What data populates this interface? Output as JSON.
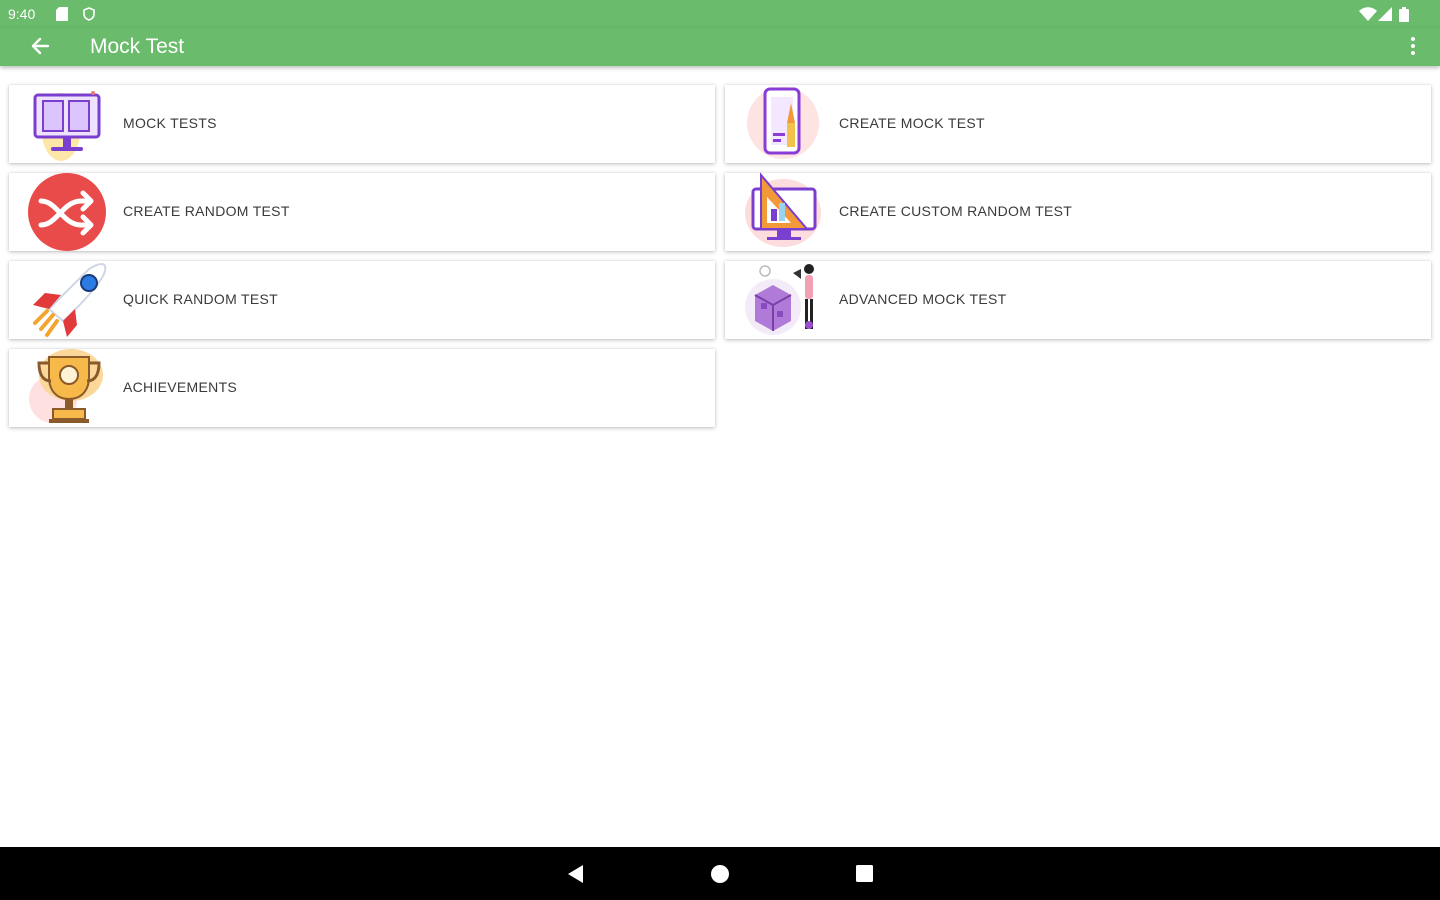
{
  "status_bar": {
    "time": "9:40",
    "left_icons": [
      "sd-card-icon",
      "shield-icon"
    ],
    "right_icons": [
      "wifi-icon",
      "signal-icon",
      "battery-icon"
    ]
  },
  "app_bar": {
    "title": "Mock Test",
    "back_icon": "arrow-back-icon",
    "menu_icon": "more-vertical-icon"
  },
  "menu_items": [
    {
      "label": "MOCK TESTS",
      "icon": "monitor-books-icon"
    },
    {
      "label": "CREATE MOCK TEST",
      "icon": "phone-pencil-icon"
    },
    {
      "label": "CREATE RANDOM TEST",
      "icon": "shuffle-icon"
    },
    {
      "label": "CREATE CUSTOM RANDOM TEST",
      "icon": "geometry-monitor-icon"
    },
    {
      "label": "QUICK RANDOM TEST",
      "icon": "rocket-icon"
    },
    {
      "label": "ADVANCED MOCK TEST",
      "icon": "cube-person-icon"
    },
    {
      "label": "ACHIEVEMENTS",
      "icon": "trophy-icon"
    }
  ],
  "nav_bar": {
    "icons": [
      "nav-back-icon",
      "nav-home-icon",
      "nav-recents-icon"
    ]
  },
  "colors": {
    "app_bar": "#6abb6c",
    "background": "#ffffff",
    "nav_bar": "#000000",
    "shuffle_red": "#e94b4b",
    "accent_purple": "#8a3dd6"
  }
}
